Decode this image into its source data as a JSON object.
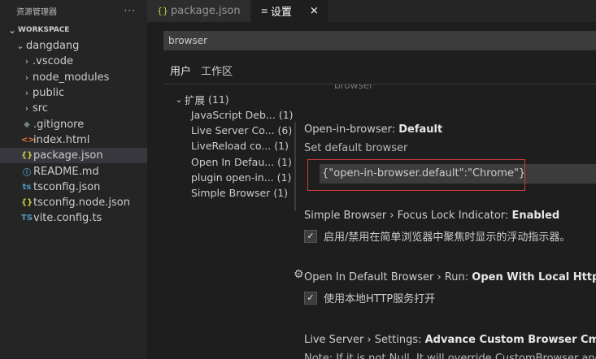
{
  "explorer": {
    "title": "资源管理器",
    "more": "···",
    "workspace_label": "WORKSPACE",
    "tree": [
      {
        "label": "dangdang",
        "indent": 0,
        "chevron": "⌄",
        "icon": "",
        "icon_color": ""
      },
      {
        "label": ".vscode",
        "indent": 1,
        "chevron": "›",
        "icon": "",
        "icon_color": ""
      },
      {
        "label": "node_modules",
        "indent": 1,
        "chevron": "›",
        "icon": "",
        "icon_color": ""
      },
      {
        "label": "public",
        "indent": 1,
        "chevron": "›",
        "icon": "",
        "icon_color": ""
      },
      {
        "label": "src",
        "indent": 1,
        "chevron": "›",
        "icon": "",
        "icon_color": ""
      },
      {
        "label": ".gitignore",
        "indent": 1,
        "chevron": "",
        "icon": "◆",
        "icon_color": "#6d8086"
      },
      {
        "label": "index.html",
        "indent": 1,
        "chevron": "",
        "icon": "<>",
        "icon_color": "#e37933"
      },
      {
        "label": "package.json",
        "indent": 1,
        "chevron": "",
        "icon": "{}",
        "icon_color": "#cbcb41",
        "selected": true
      },
      {
        "label": "README.md",
        "indent": 1,
        "chevron": "",
        "icon": "ⓘ",
        "icon_color": "#519aba"
      },
      {
        "label": "tsconfig.json",
        "indent": 1,
        "chevron": "",
        "icon": "ts",
        "icon_color": "#519aba"
      },
      {
        "label": "tsconfig.node.json",
        "indent": 1,
        "chevron": "",
        "icon": "{}",
        "icon_color": "#cbcb41"
      },
      {
        "label": "vite.config.ts",
        "indent": 1,
        "chevron": "",
        "icon": "TS",
        "icon_color": "#519aba"
      }
    ]
  },
  "tabs": [
    {
      "label": "package.json",
      "icon": "{}",
      "icon_color": "#cbcb41",
      "active": false
    },
    {
      "label": "设置",
      "icon": "≡",
      "icon_color": "#cccccc",
      "active": true,
      "close": "×"
    }
  ],
  "search": {
    "value": "browser"
  },
  "scope": {
    "user": "用户",
    "workspace": "工作区"
  },
  "toc": {
    "group_label": "扩展",
    "group_count": "(11)",
    "entries": [
      {
        "label": "JavaScript Deb...",
        "count": "(1)"
      },
      {
        "label": "Live Server Co...",
        "count": "(6)"
      },
      {
        "label": "LiveReload co...",
        "count": "(1)"
      },
      {
        "label": "Open In Defau...",
        "count": "(1)"
      },
      {
        "label": "plugin open-in...",
        "count": "(1)"
      },
      {
        "label": "Simple Browser",
        "count": "(1)"
      }
    ]
  },
  "settings": {
    "cut_top": "browser",
    "s1": {
      "prefix": "Open-in-browser: ",
      "key": "Default",
      "desc": "Set default browser",
      "value": "{\"open-in-browser.default\":\"Chrome\"}"
    },
    "s2": {
      "prefix": "Simple Browser › Focus Lock Indicator: ",
      "key": "Enabled",
      "check": "✓",
      "text": "启用/禁用在简单浏览器中聚焦时显示的浮动指示器。"
    },
    "s3": {
      "prefix": "Open In Default Browser › Run: ",
      "key": "Open With Local Http",
      "check": "✓",
      "text": "使用本地HTTP服务打开"
    },
    "s4": {
      "prefix": "Live Server › Settings: ",
      "key": "Advance Custom Browser Cmd Line",
      "desc": "Note: If it is not Null, It will override CustomBrowser and ..."
    },
    "gear": "⚙"
  },
  "colors": {
    "highlight": "#d23b3b",
    "selected_row": "#37373d"
  }
}
